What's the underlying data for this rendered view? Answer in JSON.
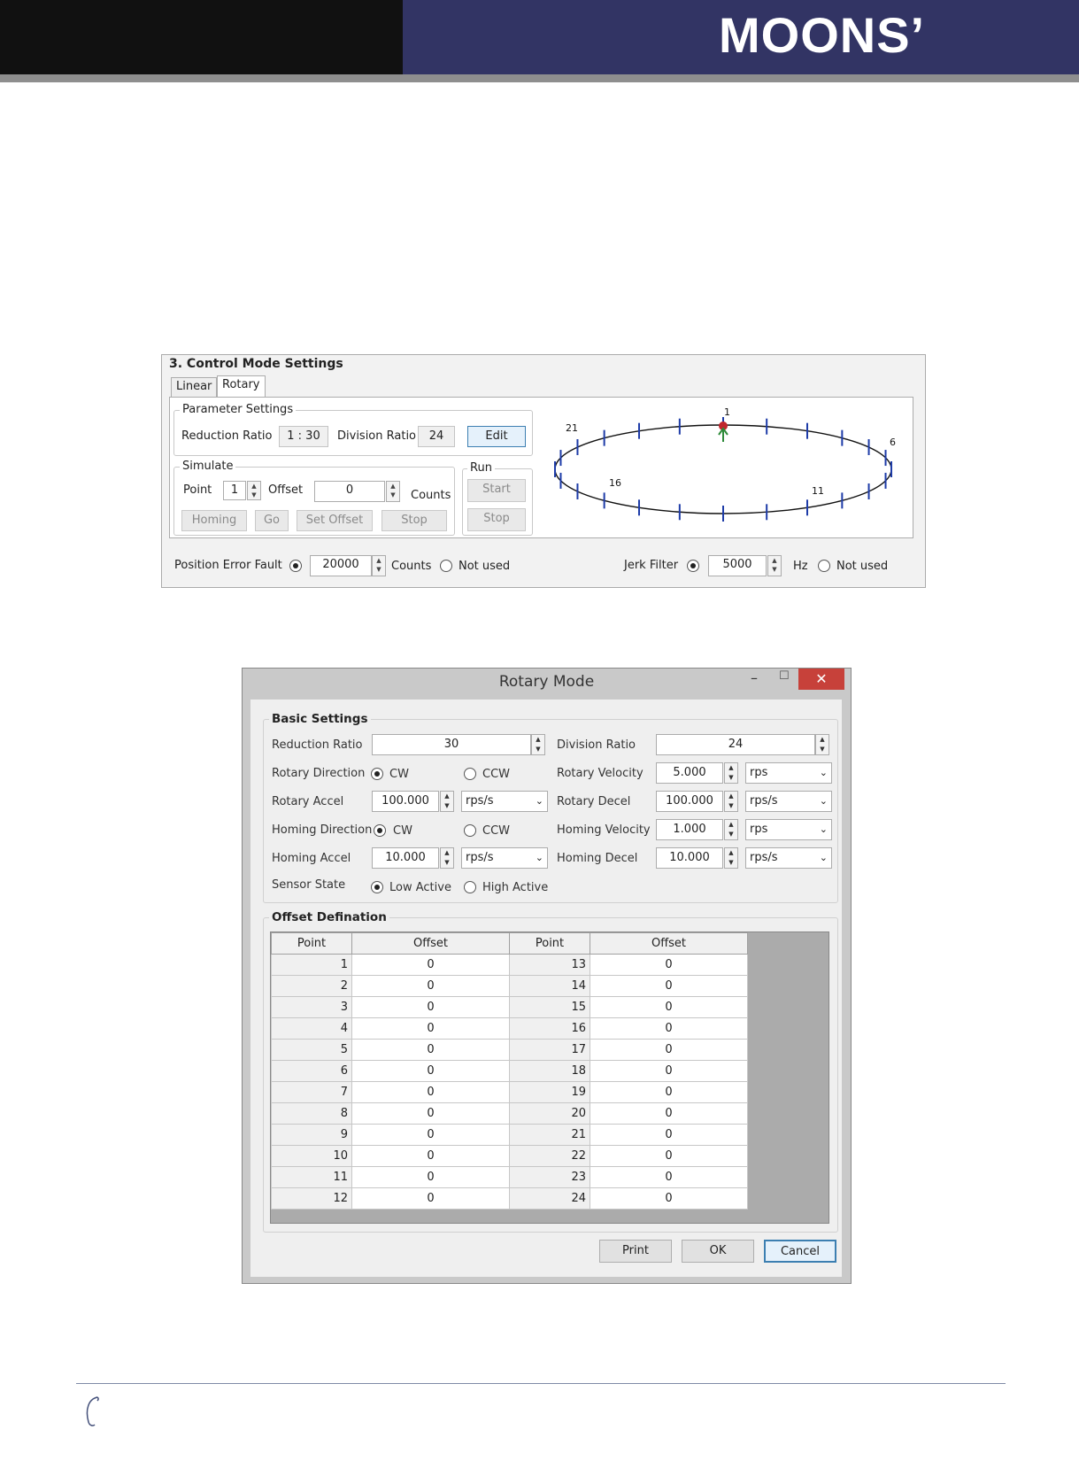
{
  "brand": {
    "logo_text": "MOONS’"
  },
  "control_panel": {
    "title": "3. Control Mode Settings",
    "tabs": [
      {
        "label": "Linear",
        "active": false
      },
      {
        "label": "Rotary",
        "active": true
      }
    ],
    "parameter_settings": {
      "title": "Parameter Settings",
      "reduction_ratio_label": "Reduction Ratio",
      "reduction_ratio_value": "1 : 30",
      "division_ratio_label": "Division Ratio",
      "division_ratio_value": "24",
      "edit_label": "Edit"
    },
    "simulate": {
      "title": "Simulate",
      "point_label": "Point",
      "point_value": "1",
      "offset_label": "Offset",
      "offset_value": "0",
      "counts_label": "Counts",
      "homing_label": "Homing",
      "go_label": "Go",
      "set_offset_label": "Set Offset",
      "stop_label": "Stop"
    },
    "run": {
      "title": "Run",
      "start_label": "Start",
      "stop_label": "Stop"
    },
    "dial": {
      "labels": [
        "1",
        "6",
        "11",
        "16",
        "21"
      ],
      "divisions": 24,
      "marker_color": "#c0262d",
      "arrow_color": "#2e8b3a",
      "tick_color": "#1e3ca8"
    },
    "position_error": {
      "label": "Position Error Fault",
      "value": "20000",
      "unit": "Counts",
      "not_used": "Not used",
      "selected": "value"
    },
    "jerk_filter": {
      "label": "Jerk Filter",
      "value": "5000",
      "unit": "Hz",
      "not_used": "Not used",
      "selected": "value"
    }
  },
  "dialog": {
    "title": "Rotary Mode",
    "close_symbol": "✕",
    "minimize_symbol": "–",
    "maximize_symbol": "☐",
    "basic_settings": {
      "title": "Basic Settings",
      "reduction_ratio": {
        "label": "Reduction Ratio",
        "value": "30"
      },
      "division_ratio": {
        "label": "Division Ratio",
        "value": "24"
      },
      "rotary_direction": {
        "label": "Rotary Direction",
        "cw": "CW",
        "ccw": "CCW",
        "selected": "CW"
      },
      "rotary_velocity": {
        "label": "Rotary Velocity",
        "value": "5.000",
        "unit": "rps"
      },
      "rotary_accel": {
        "label": "Rotary Accel",
        "value": "100.000",
        "unit": "rps/s"
      },
      "rotary_decel": {
        "label": "Rotary Decel",
        "value": "100.000",
        "unit": "rps/s"
      },
      "homing_direction": {
        "label": "Homing Direction",
        "cw": "CW",
        "ccw": "CCW",
        "selected": "CW"
      },
      "homing_velocity": {
        "label": "Homing Velocity",
        "value": "1.000",
        "unit": "rps"
      },
      "homing_accel": {
        "label": "Homing Accel",
        "value": "10.000",
        "unit": "rps/s"
      },
      "homing_decel": {
        "label": "Homing Decel",
        "value": "10.000",
        "unit": "rps/s"
      },
      "sensor_state": {
        "label": "Sensor State",
        "low": "Low Active",
        "high": "High Active",
        "selected": "Low Active"
      }
    },
    "offset_definition": {
      "title": "Offset Defination",
      "columns": [
        "Point",
        "Offset",
        "Point",
        "Offset"
      ],
      "rows": [
        [
          "1",
          "0",
          "13",
          "0"
        ],
        [
          "2",
          "0",
          "14",
          "0"
        ],
        [
          "3",
          "0",
          "15",
          "0"
        ],
        [
          "4",
          "0",
          "16",
          "0"
        ],
        [
          "5",
          "0",
          "17",
          "0"
        ],
        [
          "6",
          "0",
          "18",
          "0"
        ],
        [
          "7",
          "0",
          "19",
          "0"
        ],
        [
          "8",
          "0",
          "20",
          "0"
        ],
        [
          "9",
          "0",
          "21",
          "0"
        ],
        [
          "10",
          "0",
          "22",
          "0"
        ],
        [
          "11",
          "0",
          "23",
          "0"
        ],
        [
          "12",
          "0",
          "24",
          "0"
        ]
      ]
    },
    "buttons": {
      "print": "Print",
      "ok": "OK",
      "cancel": "Cancel"
    }
  }
}
